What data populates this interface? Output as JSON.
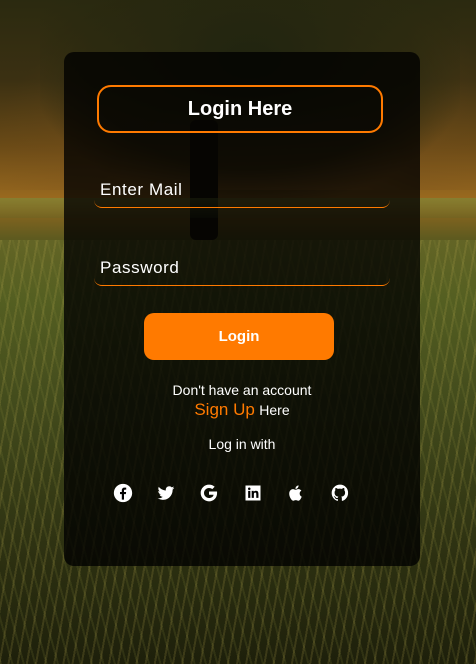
{
  "login": {
    "title": "Login Here",
    "email_placeholder": "Enter Mail",
    "password_placeholder": "Password",
    "login_button": "Login",
    "no_account_text": "Don't have an account",
    "signup_link": "Sign Up",
    "signup_suffix": "Here",
    "login_with_text": "Log in with",
    "social_icons": [
      "facebook-icon",
      "twitter-icon",
      "google-icon",
      "linkedin-icon",
      "apple-icon",
      "github-icon"
    ]
  },
  "colors": {
    "accent": "#ff7a00",
    "card_background": "rgba(0,0,0,0.78)",
    "text": "#ffffff"
  }
}
